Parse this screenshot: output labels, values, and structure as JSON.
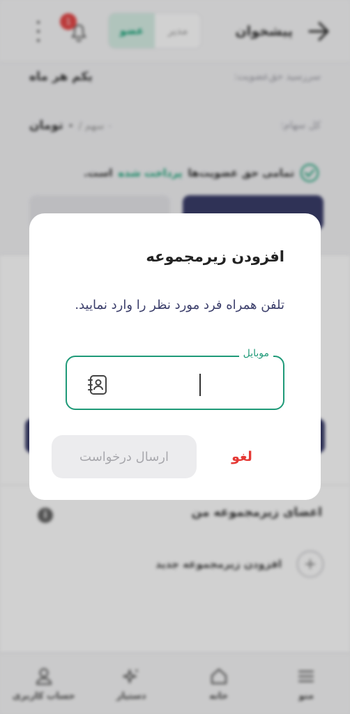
{
  "header": {
    "title": "پیشخوان",
    "role_inactive": "مدیر",
    "role_active": "عضو",
    "notification_count": "1"
  },
  "summary": {
    "due_label": "سررسید حق‌عضویت:",
    "due_value": "یکم هر ماه",
    "shares_label": "کل سهام:",
    "shares_count": "۰ سهم /",
    "shares_amount": "۰ تومان",
    "paid_prefix": "تمامی حق عضویت‌ها",
    "paid_accent": "پرداخت شده",
    "paid_suffix": "است."
  },
  "members": {
    "title": "اعضای زیرمجموعه من",
    "add_label": "افزودن زیرمجموعه جدید"
  },
  "nav": {
    "menu": "منو",
    "home": "خانه",
    "assistant": "دستیار",
    "account": "حساب کاربری"
  },
  "dialog": {
    "title": "افزودن زیرمجموعه",
    "description": "تلفن همراه فرد مورد نظر را وارد نمایید.",
    "field_label": "موبایل",
    "field_value": "",
    "cancel_label": "لغو",
    "submit_label": "ارسال درخواست"
  },
  "colors": {
    "accent": "#1f9a78",
    "danger": "#e53935",
    "primary_dark": "#3a3d6a"
  }
}
